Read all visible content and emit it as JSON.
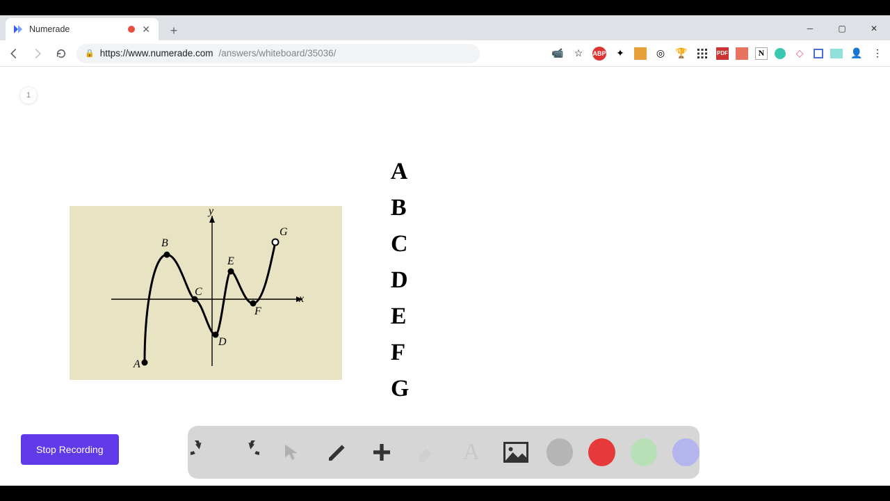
{
  "tab": {
    "title": "Numerade"
  },
  "url": {
    "host": "https://www.numerade.com",
    "path": "/answers/whiteboard/35036/"
  },
  "page_number": "1",
  "figure": {
    "y_label": "y",
    "x_label": "x",
    "points": {
      "A": "A",
      "B": "B",
      "C": "C",
      "D": "D",
      "E": "E",
      "F": "F",
      "G": "G"
    }
  },
  "handwritten": [
    "A",
    "B",
    "C",
    "D",
    "E",
    "F",
    "G"
  ],
  "stop_button": "Stop Recording",
  "whiteboard_tools": {
    "undo": "undo",
    "redo": "redo",
    "select": "select",
    "pen": "pen",
    "add": "add",
    "eraser": "eraser",
    "text": "text",
    "image": "image"
  },
  "colors": {
    "gray": "#b5b5b5",
    "red": "#e63939",
    "green": "#b7e0b7",
    "blue": "#b4b4ef"
  },
  "selected_color": "red"
}
